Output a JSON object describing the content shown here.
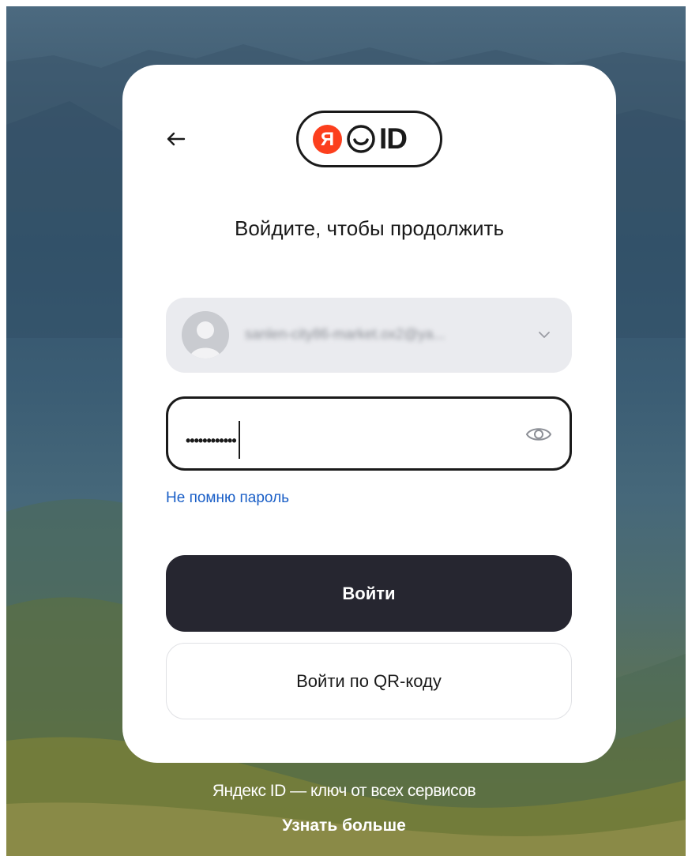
{
  "logo": {
    "ya_letter": "Я",
    "id_text": "ID",
    "brand_color": "#fc3f1d"
  },
  "heading": "Войдите, чтобы продолжить",
  "account": {
    "email": "sanlen-city86-market.ox2@ya...",
    "avatar_icon": "user-silhouette-icon",
    "chevron_icon": "chevron-down-icon"
  },
  "password": {
    "masked_value": "••••••••••••",
    "visibility_icon": "eye-icon"
  },
  "forgot_password": "Не помню пароль",
  "login_button": "Войти",
  "qr_button": "Войти по QR-коду",
  "footer": {
    "tagline": "Яндекс ID — ключ от всех сервисов",
    "learn_more": "Узнать больше"
  },
  "colors": {
    "primary_button": "#262630",
    "link": "#1a5fc7",
    "field_background": "#eaebef"
  }
}
